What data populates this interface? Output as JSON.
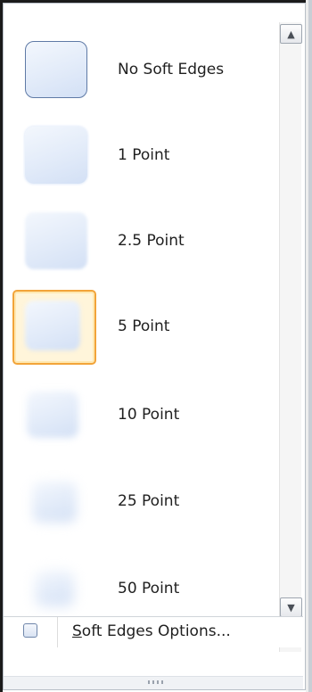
{
  "gallery": {
    "items": [
      {
        "label": "No Soft Edges",
        "icon": "no-soft-edges-preview"
      },
      {
        "label": "1 Point",
        "icon": "soft-edge-1pt-preview"
      },
      {
        "label": "2.5 Point",
        "icon": "soft-edge-2-5pt-preview"
      },
      {
        "label": "5 Point",
        "icon": "soft-edge-5pt-preview",
        "selected": true
      },
      {
        "label": "10 Point",
        "icon": "soft-edge-10pt-preview"
      },
      {
        "label": "25 Point",
        "icon": "soft-edge-25pt-preview"
      },
      {
        "label": "50 Point",
        "icon": "soft-edge-50pt-preview"
      }
    ]
  },
  "scrollbar": {
    "up_glyph": "▲",
    "down_glyph": "▼"
  },
  "footer": {
    "options_label_prefix": "S",
    "options_label_rest": "oft Edges Options..."
  },
  "colors": {
    "selection_border": "#f2a43a",
    "selection_fill": "#fff5da",
    "thumb_fill": "#e2ebf9"
  }
}
